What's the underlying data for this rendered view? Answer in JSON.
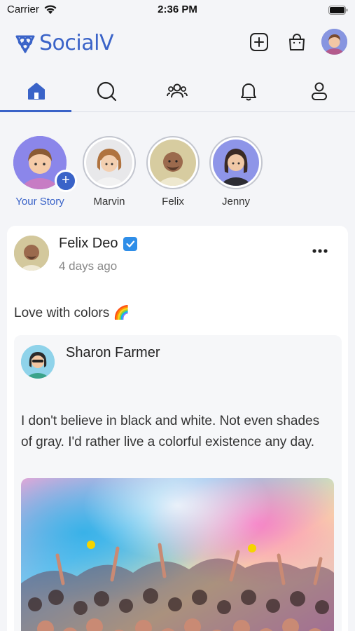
{
  "status_bar": {
    "carrier": "Carrier",
    "time": "2:36 PM"
  },
  "app": {
    "name": "SocialV",
    "brand_color": "#3a63c8"
  },
  "header_actions": [
    "add-icon",
    "bag-icon",
    "profile-avatar"
  ],
  "tabs": [
    {
      "icon": "home-icon",
      "active": true
    },
    {
      "icon": "search-icon"
    },
    {
      "icon": "groups-icon"
    },
    {
      "icon": "bell-icon"
    },
    {
      "icon": "user-icon"
    }
  ],
  "stories": [
    {
      "label": "Your Story"
    },
    {
      "label": "Marvin"
    },
    {
      "label": "Felix"
    },
    {
      "label": "Jenny"
    }
  ],
  "post": {
    "author": "Felix Deo",
    "verified": true,
    "time": "4 days ago",
    "text": "Love with colors 🌈",
    "shared": {
      "author": "Sharon Farmer",
      "text": "I don't believe in black and white. Not even shades of gray. I'd rather live a colorful existence any day."
    }
  }
}
